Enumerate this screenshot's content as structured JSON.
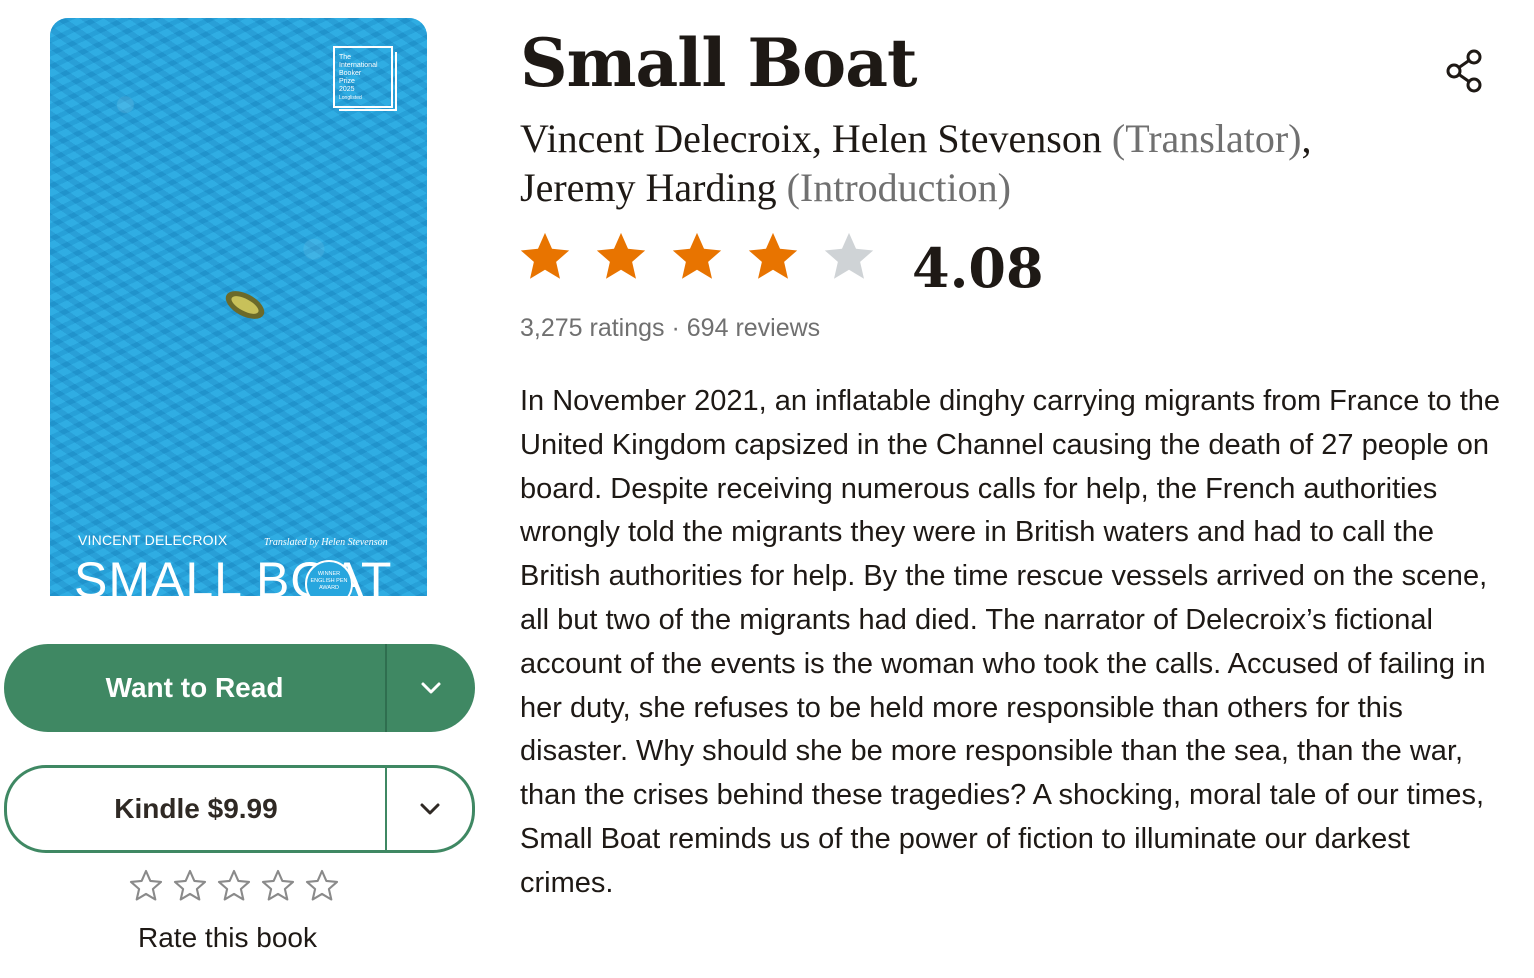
{
  "cover": {
    "prize_lines": [
      "The",
      "International",
      "Booker",
      "Prize",
      "2025",
      "Longlisted"
    ],
    "author": "VINCENT DELECROIX",
    "translator_credit": "Translated by Helen Stevenson",
    "title": "SMALL BOAT",
    "award_lines": [
      "WINNER",
      "ENGLISH PEN",
      "AWARD"
    ]
  },
  "actions": {
    "want_to_read": "Want to Read",
    "kindle": "Kindle $9.99"
  },
  "user_rating": {
    "stars": 0,
    "label": "Rate this book"
  },
  "book": {
    "title": "Small Boat",
    "contributors": [
      {
        "name": "Vincent Delecroix",
        "role": ""
      },
      {
        "name": "Helen Stevenson",
        "role": "(Translator)"
      },
      {
        "name": "Jeremy Harding",
        "role": "(Introduction)"
      }
    ],
    "average_rating": "4.08",
    "rating_stars": 4,
    "ratings_count": "3,275 ratings",
    "reviews_count": "694 reviews",
    "description": "In November 2021, an inflatable dinghy carrying migrants from France to the United Kingdom capsized in the Channel causing the death of 27 people on board. Despite receiving numerous calls for help, the French authorities wrongly told the migrants they were in British waters and had to call the British authorities for help. By the time rescue vessels arrived on the scene, all but two of the migrants had died. The narrator of Delecroix’s fictional account of the events is the woman who took the calls. Accused of failing in her duty, she refuses to be held more responsible than others for this disaster. Why should she be more responsible than the sea, than the war, than the crises behind these tragedies? A shocking, moral tale of our times, Small Boat reminds us of the power of fiction to illuminate our darkest crimes."
  },
  "colors": {
    "accent_green": "#3f8863",
    "star_orange": "#e87400",
    "star_gray": "#cfd3d6",
    "muted_text": "#707070"
  },
  "icons": [
    "share-icon",
    "chevron-down-icon",
    "star-icon",
    "star-outline-icon"
  ]
}
